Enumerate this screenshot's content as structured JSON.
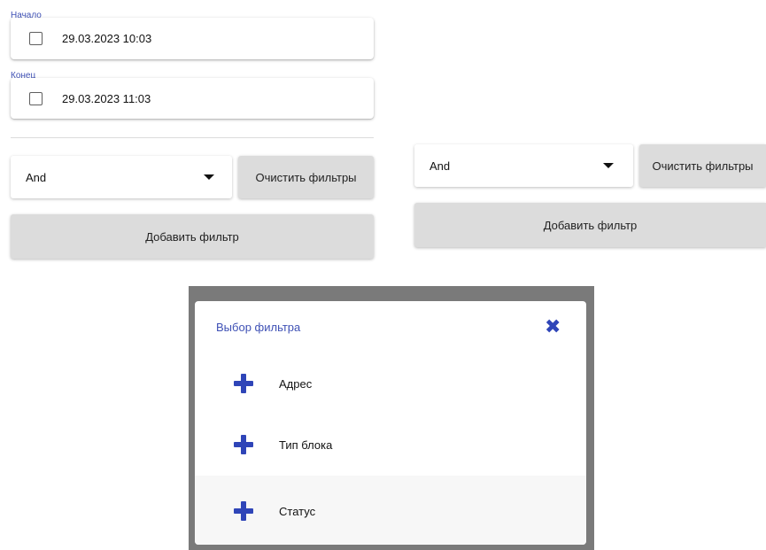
{
  "date_range": {
    "start": {
      "legend": "Начало",
      "value": "29.03.2023 10:03",
      "checked": false
    },
    "end": {
      "legend": "Конец",
      "value": "29.03.2023 11:03",
      "checked": false
    }
  },
  "left_panel": {
    "operator_select": {
      "value": "And"
    },
    "clear_filters_label": "Очистить фильтры",
    "add_filter_label": "Добавить фильтр"
  },
  "right_panel": {
    "operator_select": {
      "value": "And"
    },
    "clear_filters_label": "Очистить фильтры",
    "add_filter_label": "Добавить фильтр"
  },
  "filter_dialog": {
    "title": "Выбор фильтра",
    "close_icon": "close-icon",
    "items": [
      {
        "label": "Адрес",
        "icon": "plus-icon"
      },
      {
        "label": "Тип блока",
        "icon": "plus-icon"
      },
      {
        "label": "Статус",
        "icon": "plus-icon"
      }
    ]
  },
  "colors": {
    "accent": "#2f45b8",
    "legend_text": "#3f51b5",
    "button_gray": "#dcdcdc",
    "backdrop": "#7a7a7a"
  }
}
